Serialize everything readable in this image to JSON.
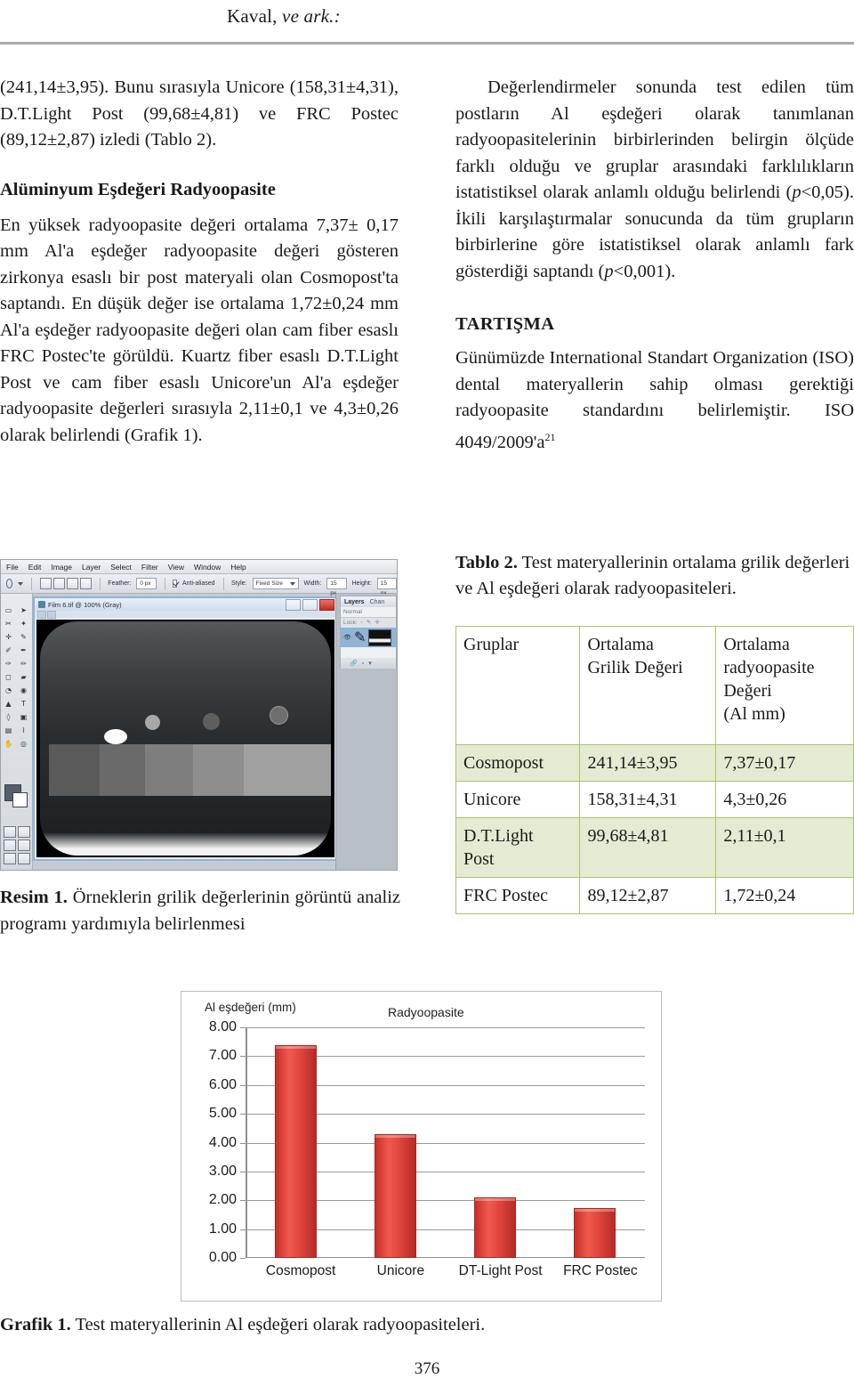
{
  "running_head": {
    "author": "Kaval,",
    "etal": "ve ark.:"
  },
  "left_column": {
    "paragraph_1": "(241,14±3,95). Bunu sırasıyla Unicore (158,31±4,31), D.T.Light Post (99,68±4,81) ve FRC Postec (89,12±2,87) izledi (Tablo 2).",
    "heading": "Alüminyum Eşdeğeri Radyoopasite",
    "paragraph_2": "En yüksek radyoopasite değeri ortalama 7,37± 0,17 mm Al'a eşdeğer radyoopasite değeri gösteren zirkonya esaslı bir post materyali olan Cosmopost'ta saptandı. En düşük değer ise ortalama 1,72±0,24 mm Al'a eşdeğer radyoopasite değeri olan cam fiber esaslı FRC Postec'te görüldü. Kuartz fiber esaslı D.T.Light Post ve cam fiber esaslı Unicore'un Al'a eşdeğer radyoopasite değerleri sırasıyla 2,11±0,1 ve 4,3±0,26 olarak belirlendi (Grafik 1)."
  },
  "right_column": {
    "paragraph_1_a": "Değerlendirmeler sonunda test edilen tüm postların Al eşdeğeri olarak tanımlanan radyoopasitelerinin birbirlerinden belirgin ölçüde farklı olduğu ve gruplar arasındaki farklılıkların istatistiksel olarak anlamlı olduğu belirlendi (",
    "p_value_1": "p",
    "paragraph_1_b": "<0,05). İkili karşılaştırmalar sonucunda da tüm grupların birbirlerine göre istatistiksel olarak anlamlı fark gösterdiği saptandı (",
    "p_value_2": "p",
    "paragraph_1_c": "<0,001).",
    "heading": "TARTIŞMA",
    "paragraph_2_a": "Günümüzde International Standart Organization (ISO) dental materyallerin sahip olması gerektiği radyoopasite standardını belirlemiştir. ISO 4049/2009'a",
    "paragraph_2_ref": "21"
  },
  "resim": {
    "label": "Resim 1.",
    "caption": " Örneklerin grilik değerlerinin görüntü analiz programı yardımıyla belirlenmesi",
    "screenshot": {
      "menu_items": [
        "File",
        "Edit",
        "Image",
        "Layer",
        "Select",
        "Filter",
        "View",
        "Window",
        "Help"
      ],
      "options": {
        "feather_label": "Feather:",
        "feather_value": "0 px",
        "antialiased_label": "Anti-aliased",
        "style_label": "Style:",
        "style_value": "Fixed Size",
        "width_label": "Width:",
        "width_value": "15 px",
        "height_label": "Height:",
        "height_value": "15 px"
      },
      "document_title": "Film 6.tif @ 100% (Gray)",
      "panel": {
        "tab_layers": "Layers",
        "tab_channels": "Chan",
        "blend_mode": "Normal",
        "lock_label": "Lock:"
      },
      "toolbox_glyphs": [
        "⌒",
        "◔",
        "▭",
        "➤",
        "✂",
        "✎",
        "✛",
        "✐",
        "✒",
        "✏",
        "✑",
        "✦",
        "◼",
        "◉",
        "✿",
        "▰",
        "▤",
        "T",
        "◊",
        "▣",
        "▦",
        "✎",
        "✋",
        "🔍"
      ]
    }
  },
  "tablo": {
    "label": "Tablo 2.",
    "caption": " Test materyallerinin ortalama grilik değerleri ve Al eşdeğeri olarak radyoopasiteleri.",
    "headers": [
      "Gruplar",
      "Ortalama\nGrilik Değeri",
      "Ortalama\nradyoopasite\nDeğeri\n(Al mm)"
    ],
    "header_0": "Gruplar",
    "header_1_line1": "Ortalama",
    "header_1_line2": "Grilik Değeri",
    "header_2_line1": "Ortalama",
    "header_2_line2": "radyoopasite",
    "header_2_line3": "Değeri",
    "header_2_line4": "(Al mm)",
    "rows": [
      {
        "group": "Cosmopost",
        "gray": "241,14±3,95",
        "radio": "7,37±0,17"
      },
      {
        "group": "Unicore",
        "gray": "158,31±4,31",
        "radio": "4,3±0,26"
      },
      {
        "group": "D.T.Light\nPost",
        "gray": "99,68±4,81",
        "radio": "2,11±0,1"
      },
      {
        "group": "FRC Postec",
        "gray": "89,12±2,87",
        "radio": "1,72±0,24"
      }
    ],
    "row_0_group": "Cosmopost",
    "row_0_gray": "241,14±3,95",
    "row_0_radio": "7,37±0,17",
    "row_1_group": "Unicore",
    "row_1_gray": "158,31±4,31",
    "row_1_radio": "4,3±0,26",
    "row_2_group_l1": "D.T.Light",
    "row_2_group_l2": "Post",
    "row_2_gray": "99,68±4,81",
    "row_2_radio": "2,11±0,1",
    "row_3_group": "FRC Postec",
    "row_3_gray": "89,12±2,87",
    "row_3_radio": "1,72±0,24",
    "border_color": "#aac46a",
    "shade_color": "#e4ebd2"
  },
  "grafik": {
    "label": "Grafik 1.",
    "caption": " Test materyallerinin Al eşdeğeri olarak radyoopasiteleri."
  },
  "chart_data": {
    "type": "bar",
    "title": "Radyoopasite",
    "ylabel": "Al eşdeğeri (mm)",
    "xlabel": "",
    "categories": [
      "Cosmopost",
      "Unicore",
      "DT-Light Post",
      "FRC Postec"
    ],
    "values": [
      7.37,
      4.3,
      2.11,
      1.72
    ],
    "ytick_labels": [
      "8.00",
      "7.00",
      "6.00",
      "5.00",
      "4.00",
      "3.00",
      "2.00",
      "1.00",
      "0.00"
    ],
    "ytick_values": [
      8,
      7,
      6,
      5,
      4,
      3,
      2,
      1,
      0
    ],
    "ylim": [
      0,
      8
    ],
    "grid": true,
    "legend": "none",
    "bar_color": "#e0453c",
    "series": [
      {
        "name": "Radyoopasite",
        "values": [
          7.37,
          4.3,
          2.11,
          1.72
        ]
      }
    ]
  },
  "page_number": "376"
}
